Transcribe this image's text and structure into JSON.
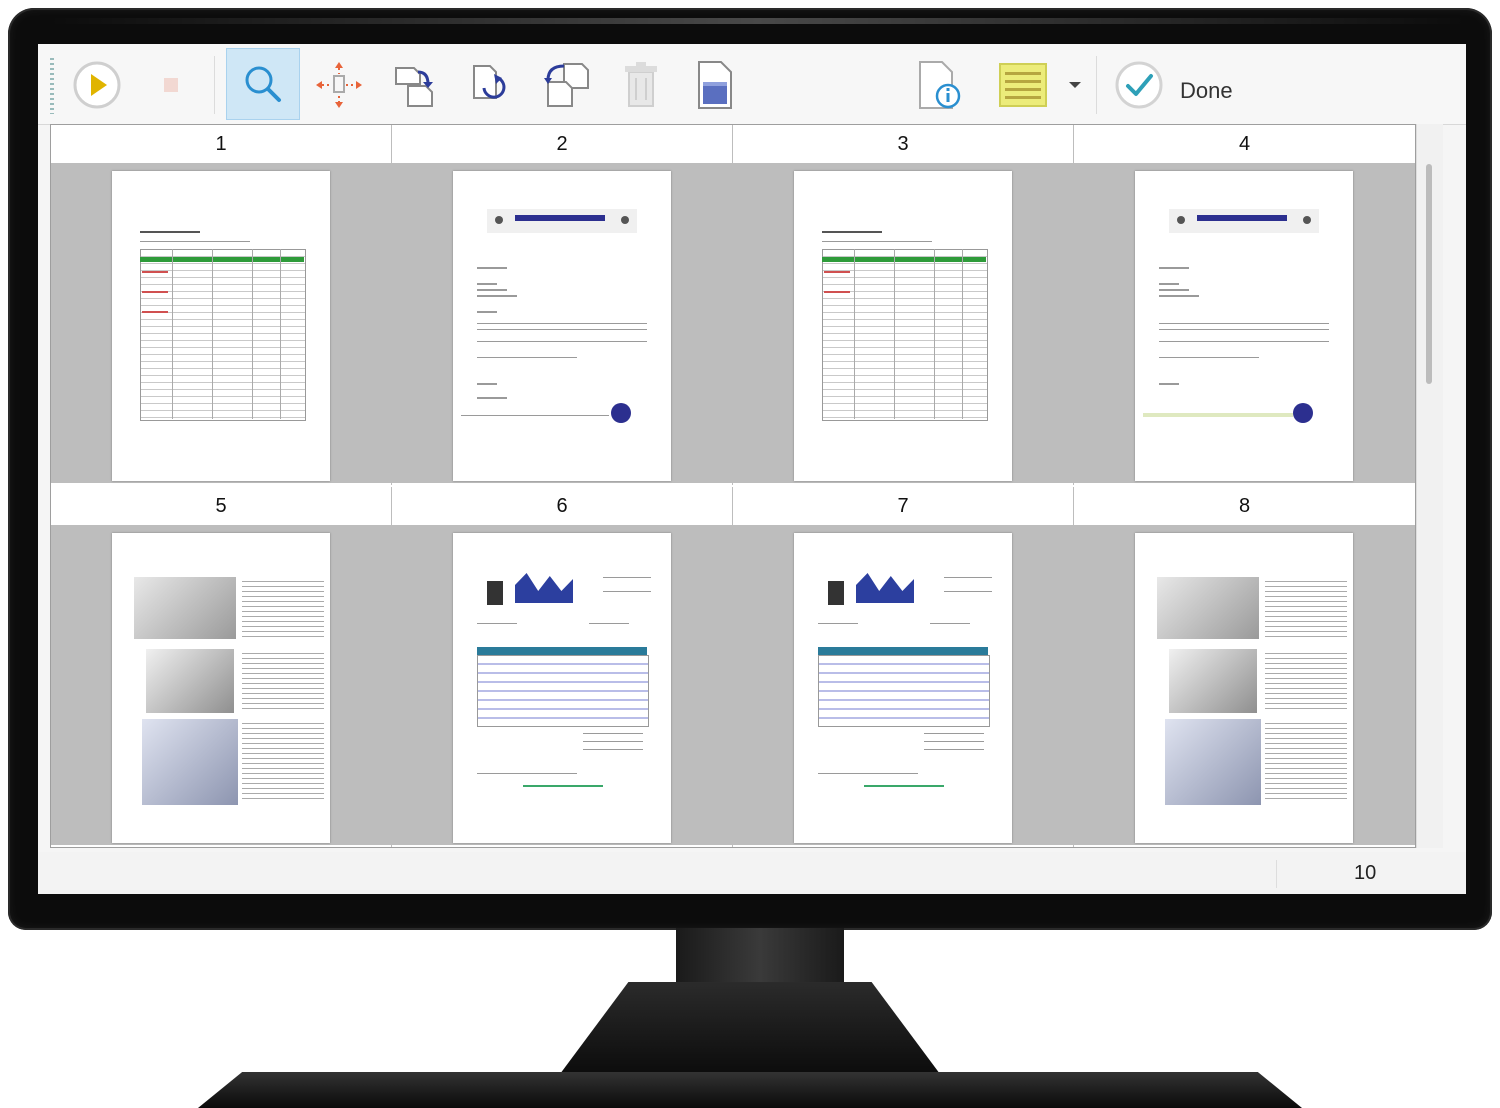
{
  "toolbar": {
    "done_label": "Done",
    "buttons": [
      {
        "icon": "play-icon"
      },
      {
        "icon": "stop-icon"
      },
      {
        "icon": "zoom-icon"
      },
      {
        "icon": "move-icon"
      },
      {
        "icon": "rotate-right-icon"
      },
      {
        "icon": "rotate-left-icon"
      },
      {
        "icon": "rotate-180-icon"
      },
      {
        "icon": "delete-icon"
      },
      {
        "icon": "page-icon"
      },
      {
        "icon": "page-info-icon"
      },
      {
        "icon": "barcode-icon"
      },
      {
        "icon": "dropdown-arrow-icon"
      },
      {
        "icon": "checkmark-icon"
      }
    ]
  },
  "pages": [
    {
      "number": "1",
      "kind": "table"
    },
    {
      "number": "2",
      "kind": "letter"
    },
    {
      "number": "3",
      "kind": "table"
    },
    {
      "number": "4",
      "kind": "letter"
    },
    {
      "number": "5",
      "kind": "brochure"
    },
    {
      "number": "6",
      "kind": "invoice"
    },
    {
      "number": "7",
      "kind": "invoice"
    },
    {
      "number": "8",
      "kind": "brochure"
    }
  ],
  "status": {
    "page_count": "10"
  },
  "colors": {
    "active_button": "#cfe7f6",
    "thumb_background": "#bdbdbd",
    "accent_green": "#2e9b3a",
    "accent_blue": "#2c2f8f"
  }
}
